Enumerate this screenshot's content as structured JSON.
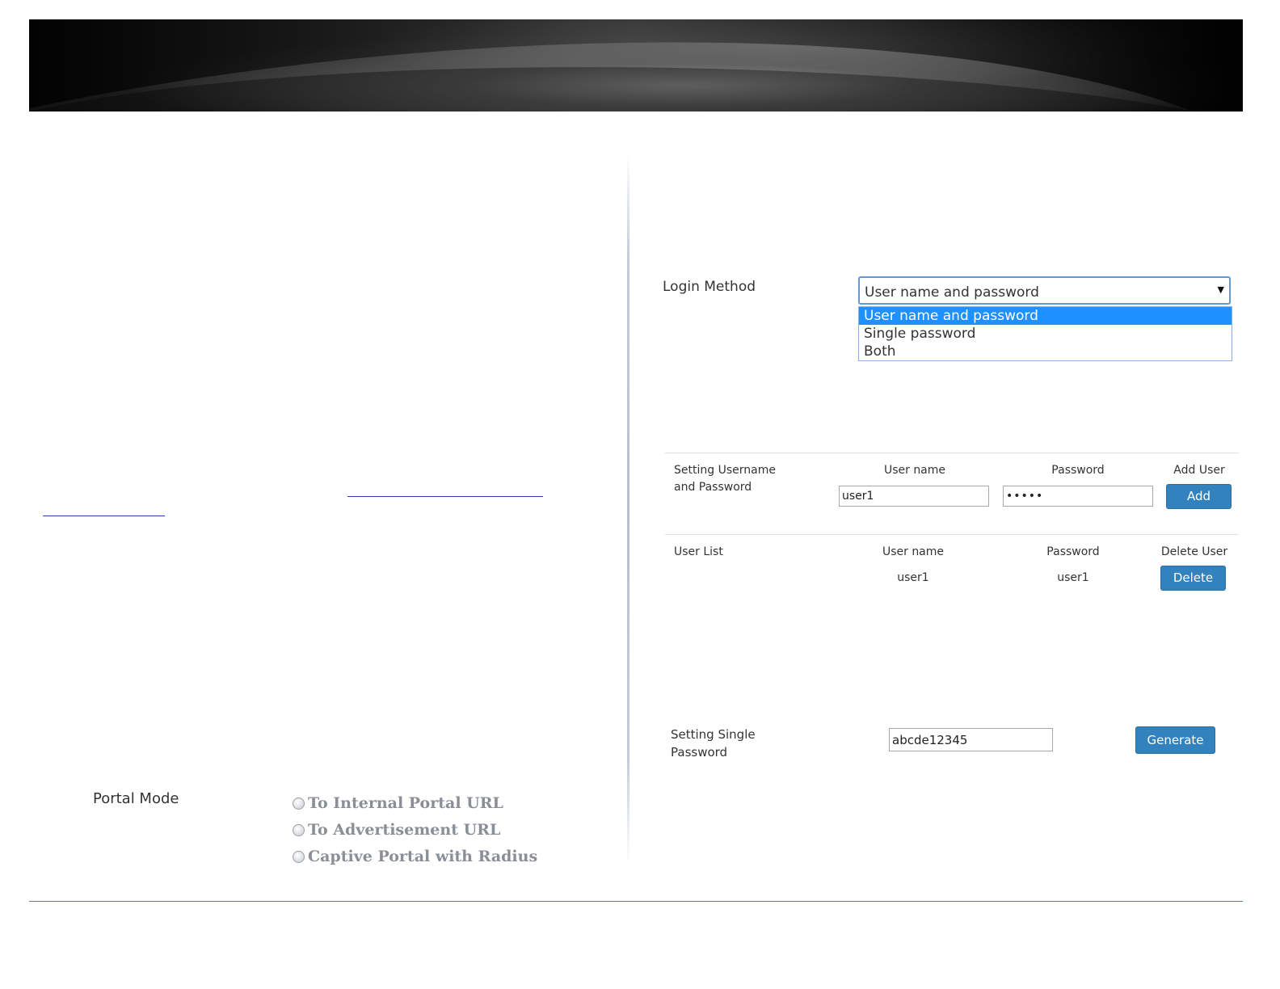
{
  "portal": {
    "label": "Portal Mode",
    "options": [
      "To Internal Portal URL",
      "To Advertisement URL",
      "Captive Portal with Radius"
    ]
  },
  "login": {
    "label": "Login Method",
    "selected": "User name and password",
    "options": [
      "User name and password",
      "Single password",
      "Both"
    ]
  },
  "setting_user": {
    "label": "Setting Username and Password",
    "col_username": "User name",
    "col_password": "Password",
    "col_add": "Add User",
    "username_value": "user1",
    "password_value": "•••••",
    "add_button": "Add"
  },
  "user_list": {
    "label": "User List",
    "col_username": "User name",
    "col_password": "Password",
    "col_delete": "Delete User",
    "rows": [
      {
        "username": "user1",
        "password": "user1"
      }
    ],
    "delete_button": "Delete"
  },
  "single_password": {
    "label": "Setting Single Password",
    "value": "abcde12345",
    "generate_button": "Generate"
  },
  "colors": {
    "accent": "#3282be",
    "selected_option": "#1e90ff",
    "footer_line": "#4f81bd"
  }
}
